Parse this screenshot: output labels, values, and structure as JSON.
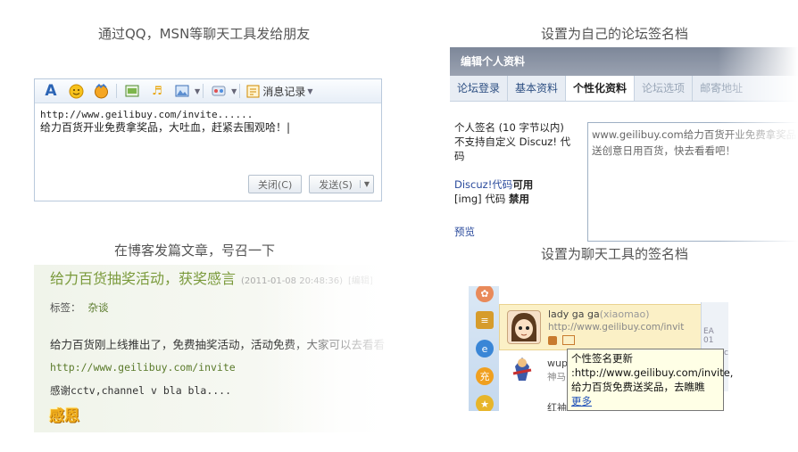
{
  "captions": {
    "qq": "通过QQ，MSN等聊天工具发给朋友",
    "forum": "设置为自己的论坛签名档",
    "blog": "在博客发篇文章，号召一下",
    "chat": "设置为聊天工具的签名档"
  },
  "qq_window": {
    "history_label": "消息记录",
    "message_line1": "http://www.geilibuy.com/invite......",
    "message_line2": "给力百货开业免费拿奖品，大吐血，赶紧去围观哈！|",
    "close_button": "关闭(C)",
    "send_button": "发送(S)"
  },
  "forum_profile": {
    "header": "编辑个人资料",
    "tabs": [
      "论坛登录",
      "基本资料",
      "个性化资料",
      "论坛选项",
      "邮寄地址"
    ],
    "active_tab": "个性化资料",
    "signature_label": "个人签名 (10 字节以内)",
    "no_custom_code": "不支持自定义 Discuz! 代码",
    "discuz_code_label": "Discuz!代码",
    "discuz_code_status": "可用",
    "img_code_label": "[img] 代码",
    "img_code_status": "禁用",
    "preview_link": "预览",
    "signature_text": "www.geilibuy.com给力百货开业免费拿奖品送创意日用百货，快去看看吧！"
  },
  "blog_post": {
    "title": "给力百货抽奖活动，获奖感言",
    "date": "(2011-01-08 20:48:36)",
    "edit_link": "[编辑]",
    "tag_label": "标签：",
    "tag": "杂谈",
    "body": "给力百货刚上线推出了，免费抽奖活动，活动免费，大家可以去看看",
    "url": "http://www.geilibuy.com/invite",
    "thanks": "感谢cctv,channel v bla bla....",
    "stamp": "感恩"
  },
  "chat_tool": {
    "contact1_name": "lady ga ga",
    "contact1_id": "(xiaomao)",
    "contact1_sig": "http://www.geilibuy.com/invit",
    "contact2_name": "wupe",
    "contact2_sub": "神马",
    "contact3_name": "红袖",
    "side_text1": "EA 01",
    "side_text2": "entific",
    "tooltip_title": "个性签名更新",
    "tooltip_body": ":http://www.geilibuy.com/invite,给力百货免费送奖品，去瞧瞧",
    "tooltip_more": "更多",
    "rail_icons": [
      "qzone-icon",
      "news-icon",
      "ie-icon",
      "charge-icon",
      "star-icon"
    ]
  }
}
